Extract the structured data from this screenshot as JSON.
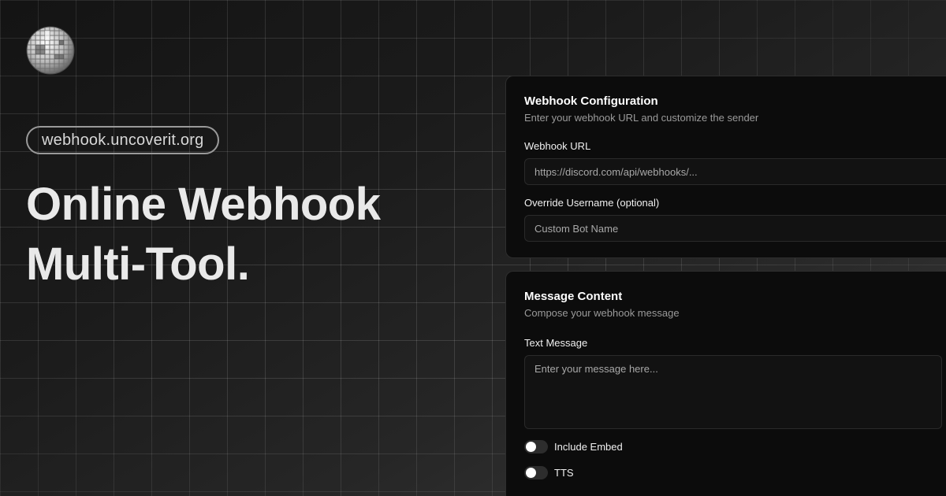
{
  "brand": {
    "logo_icon": "disco-ball-icon",
    "domain": "webhook.uncoverit.org"
  },
  "hero": {
    "line1": "Online Webhook",
    "line2": "Multi-Tool."
  },
  "config_card": {
    "title": "Webhook Configuration",
    "subtitle": "Enter your webhook URL and customize the sender",
    "url_label": "Webhook URL",
    "url_placeholder": "https://discord.com/api/webhooks/...",
    "username_label": "Override Username (optional)",
    "username_placeholder": "Custom Bot Name"
  },
  "message_card": {
    "title": "Message Content",
    "subtitle": "Compose your webhook message",
    "text_label": "Text Message",
    "text_placeholder": "Enter your message here...",
    "toggles": [
      {
        "label": "Include Embed",
        "on": false
      },
      {
        "label": "TTS",
        "on": false
      }
    ]
  },
  "colors": {
    "card_background": "#0c0c0c",
    "card_border": "#2e2e2e",
    "muted_text": "#9a9a9a",
    "headline_text": "#e9e9e9"
  }
}
